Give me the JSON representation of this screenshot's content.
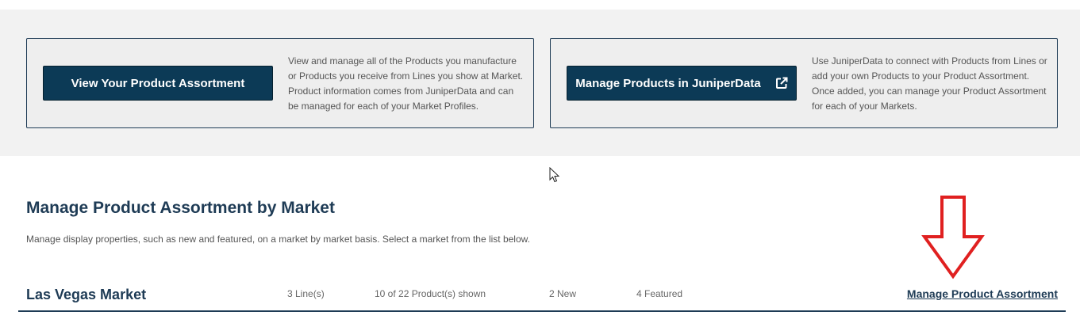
{
  "cards": [
    {
      "button_label": "View Your Product Assortment",
      "description": "View and manage all of the Products you manufacture or Products you receive from Lines you show at Market. Product information comes from JuniperData and can be managed for each of your Market Profiles."
    },
    {
      "button_label": "Manage Products in JuniperData",
      "button_icon": "external-link-icon",
      "description": "Use JuniperData to connect with Products from Lines or add your own Products to your Product Assortment. Once added, you can manage your Product Assortment for each of your Markets."
    }
  ],
  "section": {
    "title": "Manage Product Assortment by Market",
    "description": "Manage display properties, such as new and featured, on a market by market basis. Select a market from the list below."
  },
  "markets": [
    {
      "name": "Las Vegas Market",
      "lines": "3 Line(s)",
      "products": "10 of 22 Product(s) shown",
      "new": "2 New",
      "featured": "4 Featured",
      "link_label": "Manage Product Assortment"
    }
  ],
  "colors": {
    "primary": "#0c3a56",
    "heading": "#1e3b55",
    "band": "#f2f2f2",
    "annotation_arrow": "#e02020"
  }
}
